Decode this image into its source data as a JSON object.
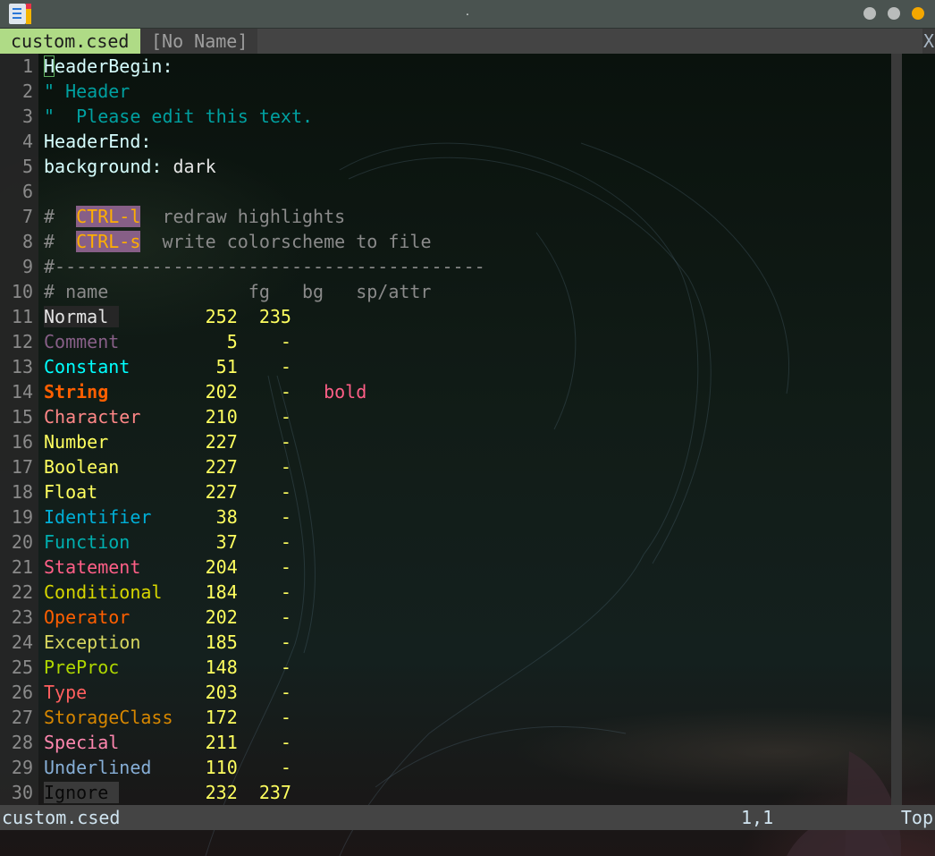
{
  "window": {
    "title": ".",
    "buttons": [
      {
        "name": "minimize",
        "color": "#b9bcbb"
      },
      {
        "name": "maximize",
        "color": "#b9bcbb"
      },
      {
        "name": "close",
        "color": "#f4a700"
      }
    ]
  },
  "tabs": [
    {
      "label": "custom.csed",
      "active": true
    },
    {
      "label": "[No Name]",
      "active": false
    }
  ],
  "tab_close_label": "X",
  "editor": {
    "lines": [
      {
        "n": "1",
        "segments": [
          {
            "t": "HeaderBegin:",
            "c": "#d7ffff",
            "cursor_first": true
          }
        ]
      },
      {
        "n": "2",
        "segments": [
          {
            "t": "\" Header",
            "c": "#00a0a0"
          }
        ]
      },
      {
        "n": "3",
        "segments": [
          {
            "t": "\"  Please edit this text.",
            "c": "#00a0a0"
          }
        ]
      },
      {
        "n": "4",
        "segments": [
          {
            "t": "HeaderEnd:",
            "c": "#d7ffff"
          }
        ]
      },
      {
        "n": "5",
        "segments": [
          {
            "t": "background:",
            "c": "#d7ffff"
          },
          {
            "t": " dark",
            "c": "#e4e4e4"
          }
        ]
      },
      {
        "n": "6",
        "segments": []
      },
      {
        "n": "7",
        "segments": [
          {
            "t": "#  ",
            "c": "#8a8a8a"
          },
          {
            "t": "CTRL-l",
            "c": "#ffaf00",
            "bg": "#875f87"
          },
          {
            "t": "  redraw highlights",
            "c": "#8a8a8a"
          }
        ]
      },
      {
        "n": "8",
        "segments": [
          {
            "t": "#  ",
            "c": "#8a8a8a"
          },
          {
            "t": "CTRL-s",
            "c": "#ffaf00",
            "bg": "#875f87"
          },
          {
            "t": "  write colorscheme to file",
            "c": "#8a8a8a"
          }
        ]
      },
      {
        "n": "9",
        "segments": [
          {
            "t": "#----------------------------------------",
            "c": "#8a8a8a"
          }
        ]
      },
      {
        "n": "10",
        "segments": [
          {
            "t": "# name             fg   bg   sp/attr",
            "c": "#8a8a8a"
          }
        ]
      }
    ],
    "table_start_line": 11,
    "groups": [
      {
        "name": "Normal",
        "fg": "252",
        "bg": "235",
        "attr": "",
        "color": "#e4e4e4",
        "bgcolor": "#262626"
      },
      {
        "name": "Comment",
        "fg": "5",
        "bg": "-",
        "attr": "",
        "color": "#875f87"
      },
      {
        "name": "Constant",
        "fg": "51",
        "bg": "-",
        "attr": "",
        "color": "#00ffff"
      },
      {
        "name": "String",
        "fg": "202",
        "bg": "-",
        "attr": "bold",
        "color": "#ff5f00",
        "bold": true
      },
      {
        "name": "Character",
        "fg": "210",
        "bg": "-",
        "attr": "",
        "color": "#ff8787"
      },
      {
        "name": "Number",
        "fg": "227",
        "bg": "-",
        "attr": "",
        "color": "#ffff5f"
      },
      {
        "name": "Boolean",
        "fg": "227",
        "bg": "-",
        "attr": "",
        "color": "#ffff5f"
      },
      {
        "name": "Float",
        "fg": "227",
        "bg": "-",
        "attr": "",
        "color": "#ffff5f"
      },
      {
        "name": "Identifier",
        "fg": "38",
        "bg": "-",
        "attr": "",
        "color": "#00afd7"
      },
      {
        "name": "Function",
        "fg": "37",
        "bg": "-",
        "attr": "",
        "color": "#00afaf"
      },
      {
        "name": "Statement",
        "fg": "204",
        "bg": "-",
        "attr": "",
        "color": "#ff5f87"
      },
      {
        "name": "Conditional",
        "fg": "184",
        "bg": "-",
        "attr": "",
        "color": "#d7d700"
      },
      {
        "name": "Operator",
        "fg": "202",
        "bg": "-",
        "attr": "",
        "color": "#ff5f00"
      },
      {
        "name": "Exception",
        "fg": "185",
        "bg": "-",
        "attr": "",
        "color": "#d7d75f"
      },
      {
        "name": "PreProc",
        "fg": "148",
        "bg": "-",
        "attr": "",
        "color": "#afd700"
      },
      {
        "name": "Type",
        "fg": "203",
        "bg": "-",
        "attr": "",
        "color": "#ff5f5f"
      },
      {
        "name": "StorageClass",
        "fg": "172",
        "bg": "-",
        "attr": "",
        "color": "#d78700"
      },
      {
        "name": "Special",
        "fg": "211",
        "bg": "-",
        "attr": "",
        "color": "#ff87af"
      },
      {
        "name": "Underlined",
        "fg": "110",
        "bg": "-",
        "attr": "",
        "color": "#87afd7"
      },
      {
        "name": "Ignore",
        "fg": "232",
        "bg": "237",
        "attr": "",
        "color": "#080808",
        "bgcolor": "#3a3a3a"
      }
    ],
    "attr_color": "#ff5f87",
    "number_color": "#ffff5f"
  },
  "statusline": {
    "filename": "custom.csed",
    "position": "1,1",
    "scroll": "Top"
  }
}
